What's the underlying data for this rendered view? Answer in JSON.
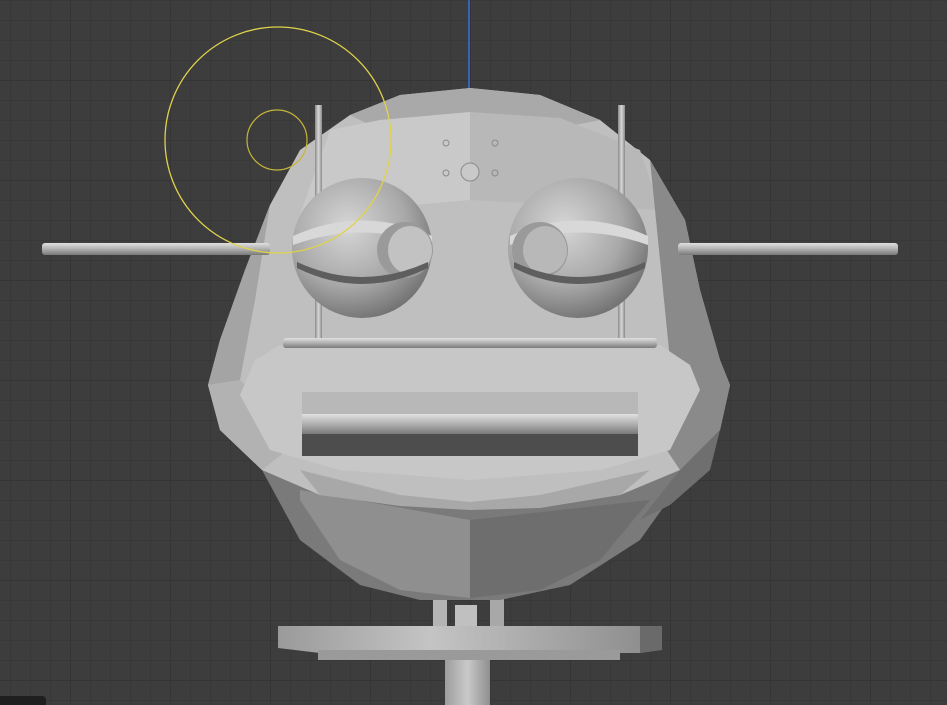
{
  "viewport": {
    "name": "3D Viewport",
    "view": "front-orthographic",
    "grid": true,
    "colors": {
      "background": "#3d3d3d",
      "grid_minor": "#383838",
      "grid_major": "#353535",
      "z_axis": "#3a6fd8",
      "brush_circle": "#e0d24a",
      "mesh": "#bdbdbd"
    }
  },
  "scene": {
    "object": "robot-head-mesh",
    "parts": [
      "head",
      "left-eye",
      "right-eye",
      "antenna-rods",
      "brow-bar",
      "mouth-slot",
      "neck",
      "base-plate"
    ]
  },
  "brush": {
    "mode": "sculpt",
    "cursor": "brush-cursor-icon"
  }
}
